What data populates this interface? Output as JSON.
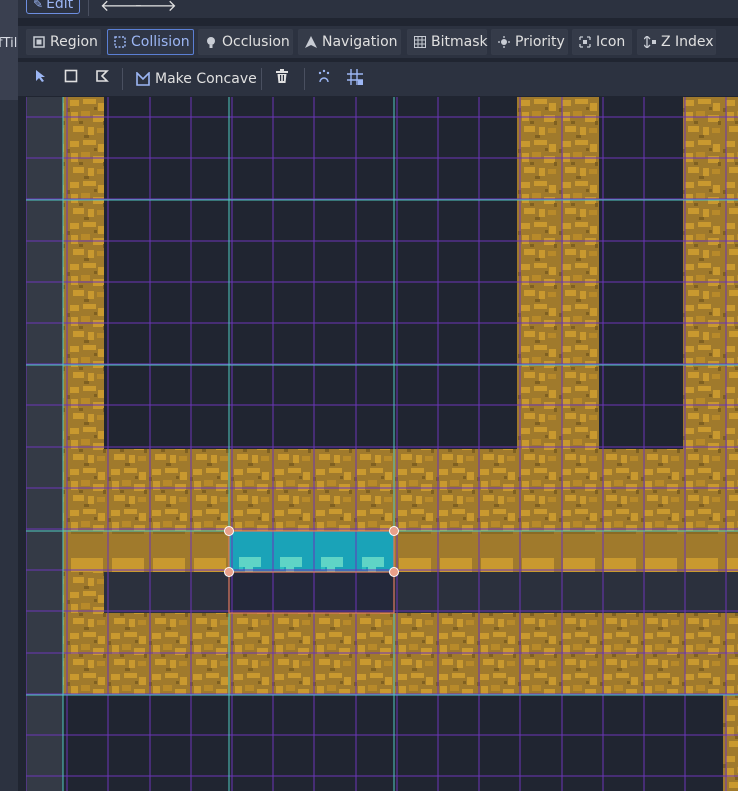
{
  "left_panel": {
    "partial_label": "fTil"
  },
  "top_bar": {
    "edit_label": "Edit",
    "back_icon": "arrow-left-icon",
    "forward_icon": "arrow-right-icon"
  },
  "modes": [
    {
      "label": "Region",
      "icon": "region-icon",
      "active": false
    },
    {
      "label": "Collision",
      "icon": "collision-icon",
      "active": true
    },
    {
      "label": "Occlusion",
      "icon": "occlusion-icon",
      "active": false
    },
    {
      "label": "Navigation",
      "icon": "navigation-icon",
      "active": false
    },
    {
      "label": "Bitmask",
      "icon": "bitmask-icon",
      "active": false
    },
    {
      "label": "Priority",
      "icon": "priority-icon",
      "active": false
    },
    {
      "label": "Icon",
      "icon": "icon-mode-icon",
      "active": false
    },
    {
      "label": "Z Index",
      "icon": "z-index-icon",
      "active": false
    }
  ],
  "tools": {
    "select_icon": "select-cursor-icon",
    "rectangle_icon": "rectangle-shape-icon",
    "polygon_icon": "polygon-shape-icon",
    "make_concave_label": "Make Concave",
    "delete_icon": "trash-icon",
    "keep_inside_icon": "keep-inside-tile-icon",
    "grid_snap_icon": "grid-snap-icon"
  },
  "colors": {
    "accent": "#6d8ee0",
    "dirt": "#a07a2c",
    "collision_fill": "#1aa3b8",
    "collision_outline": "#e07a5f",
    "grid_minor": "#6b35b8",
    "grid_major": "#4fc9c0"
  }
}
